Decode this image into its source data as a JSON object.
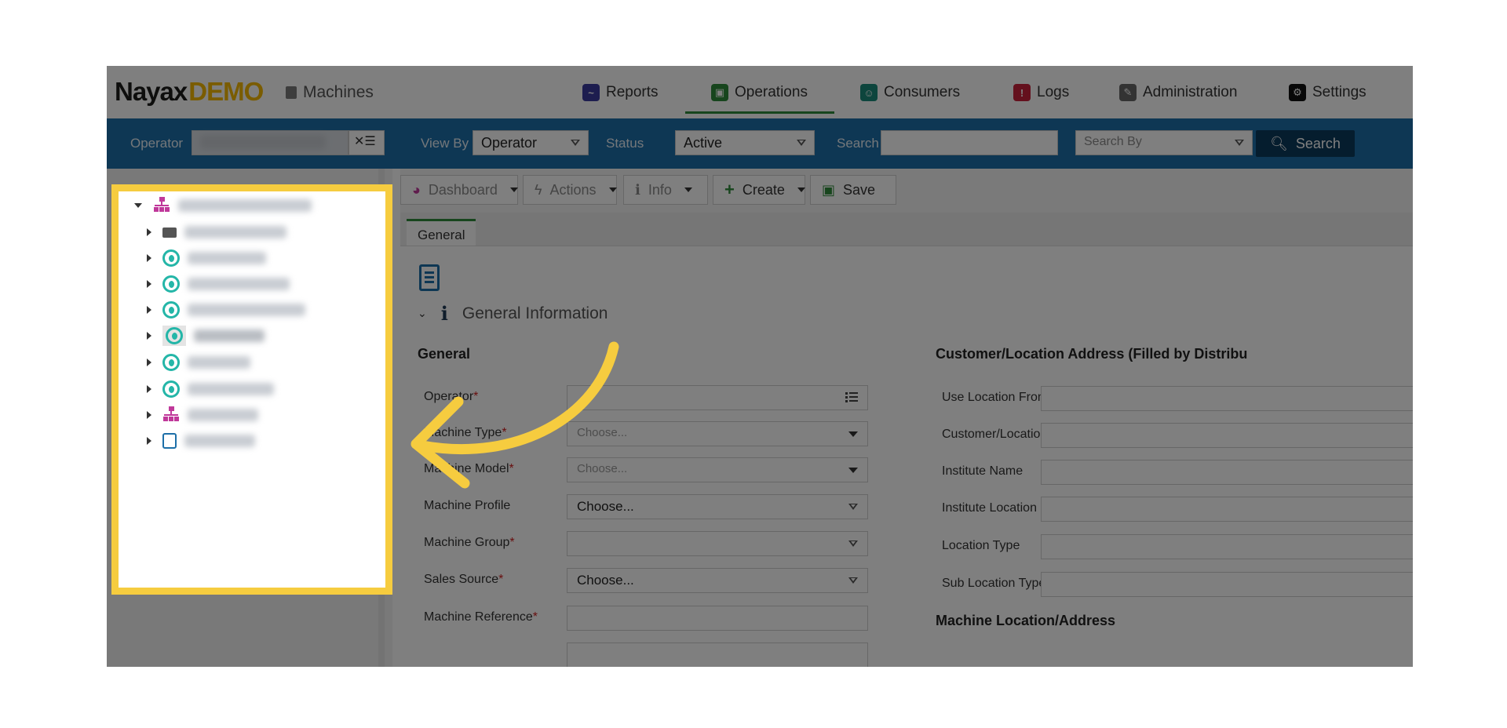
{
  "app": {
    "logo_brand": "Nayax",
    "logo_suffix": "DEMO",
    "breadcrumb": "Machines"
  },
  "nav": [
    {
      "label": "Reports",
      "icon": "reports-icon",
      "color": "#3b3b9e"
    },
    {
      "label": "Operations",
      "icon": "operations-icon",
      "color": "#2e8b3a"
    },
    {
      "label": "Consumers",
      "icon": "consumers-icon",
      "color": "#1a8a7a"
    },
    {
      "label": "Logs",
      "icon": "logs-icon",
      "color": "#c8203a"
    },
    {
      "label": "Administration",
      "icon": "administration-icon",
      "color": "#666666"
    },
    {
      "label": "Settings",
      "icon": "settings-icon",
      "color": "#111111"
    }
  ],
  "filters": {
    "operator_label": "Operator",
    "viewby_label": "View By",
    "viewby_value": "Operator",
    "status_label": "Status",
    "status_value": "Active",
    "search_label": "Search",
    "searchby_placeholder": "Search By",
    "search_button": "Search"
  },
  "toolbar": {
    "dashboard": "Dashboard",
    "actions": "Actions",
    "info": "Info",
    "create": "Create",
    "save": "Save"
  },
  "tabs": {
    "general": "General"
  },
  "section": {
    "title": "General Information",
    "left_heading": "General",
    "right_heading": "Customer/Location Address (Filled by Distribu",
    "right_heading2": "Machine Location/Address"
  },
  "left_fields": [
    {
      "label": "Operator",
      "required": "*",
      "value": ""
    },
    {
      "label": "Machine Type",
      "required": "*",
      "value": "Choose..."
    },
    {
      "label": "Machine Model",
      "required": "*",
      "value": "Choose..."
    },
    {
      "label": "Machine Profile",
      "required": "",
      "value": "Choose..."
    },
    {
      "label": "Machine Group",
      "required": "*",
      "value": ""
    },
    {
      "label": "Sales Source",
      "required": "*",
      "value": "Choose..."
    },
    {
      "label": "Machine Reference",
      "required": "*",
      "value": ""
    }
  ],
  "right_fields": [
    {
      "label": "Use Location From"
    },
    {
      "label": "Customer/Location"
    },
    {
      "label": "Institute Name"
    },
    {
      "label": "Institute Location"
    },
    {
      "label": "Location Type"
    },
    {
      "label": "Sub Location Type"
    }
  ],
  "tree": {
    "nodes": [
      {
        "icon": "org-icon",
        "expanded": true
      },
      {
        "icon": "folder-icon",
        "expanded": false
      },
      {
        "icon": "location-pin-icon",
        "expanded": false
      },
      {
        "icon": "location-pin-icon",
        "expanded": false
      },
      {
        "icon": "location-pin-icon",
        "expanded": false
      },
      {
        "icon": "location-pin-icon",
        "expanded": false,
        "selected": true
      },
      {
        "icon": "location-pin-icon",
        "expanded": false
      },
      {
        "icon": "location-pin-icon",
        "expanded": false
      },
      {
        "icon": "org-icon",
        "expanded": false
      },
      {
        "icon": "bag-icon",
        "expanded": false
      }
    ]
  },
  "colors": {
    "highlight": "#f6cc3f",
    "filterbar": "#1d6fa8",
    "search_button": "#0b3a5c",
    "active_tab": "#2e8b3a"
  }
}
